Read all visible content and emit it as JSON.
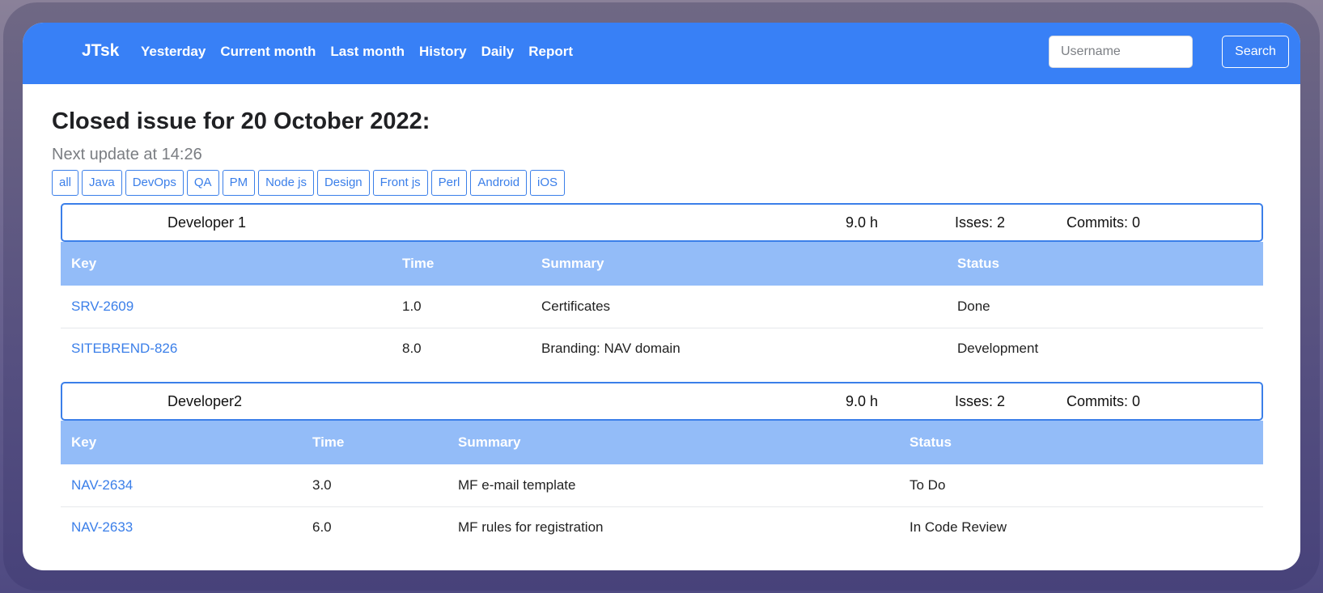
{
  "navbar": {
    "brand": "JTsk",
    "links": [
      "Yesterday",
      "Current month",
      "Last month",
      "History",
      "Daily",
      "Report"
    ],
    "search_placeholder": "Username",
    "search_button": "Search"
  },
  "page": {
    "title": "Closed issue for 20 October 2022:",
    "next_update": "Next update at 14:26",
    "filters": [
      "all",
      "Java",
      "DevOps",
      "QA",
      "PM",
      "Node js",
      "Design",
      "Front js",
      "Perl",
      "Android",
      "iOS"
    ]
  },
  "developers": [
    {
      "name": "Developer 1",
      "hours": "9.0 h",
      "issues": "Isses: 2",
      "commits": "Commits: 0",
      "columns": [
        "Key",
        "Time",
        "Summary",
        "Status"
      ],
      "rows": [
        {
          "key": "SRV-2609",
          "time": "1.0",
          "summary": "Certificates",
          "status": "Done"
        },
        {
          "key": "SITEBREND-826",
          "time": "8.0",
          "summary": "Branding: NAV domain",
          "status": "Development"
        }
      ]
    },
    {
      "name": "Developer2",
      "hours": "9.0 h",
      "issues": "Isses: 2",
      "commits": "Commits: 0",
      "columns": [
        "Key",
        "Time",
        "Summary",
        "Status"
      ],
      "rows": [
        {
          "key": "NAV-2634",
          "time": "3.0",
          "summary": "MF e-mail template",
          "status": "To Do"
        },
        {
          "key": "NAV-2633",
          "time": "6.0",
          "summary": "MF rules for registration",
          "status": "In Code Review"
        }
      ]
    }
  ],
  "colors": {
    "navbar": "#3880f6",
    "table_header": "#93bcf8",
    "link": "#3b7fe9"
  }
}
